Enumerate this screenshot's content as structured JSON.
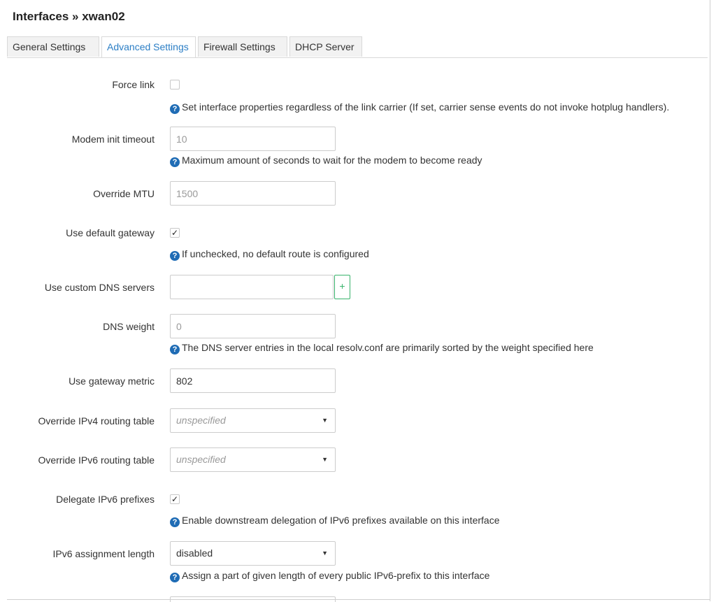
{
  "page": {
    "title": "Interfaces » xwan02"
  },
  "tabs": [
    {
      "label": "General Settings",
      "active": false
    },
    {
      "label": "Advanced Settings",
      "active": true
    },
    {
      "label": "Firewall Settings",
      "active": false
    },
    {
      "label": "DHCP Server",
      "active": false
    }
  ],
  "form": {
    "force_link": {
      "label": "Force link",
      "checked": false,
      "help": "Set interface properties regardless of the link carrier (If set, carrier sense events do not invoke hotplug handlers)."
    },
    "modem_init_timeout": {
      "label": "Modem init timeout",
      "value": "",
      "placeholder": "10",
      "help": "Maximum amount of seconds to wait for the modem to become ready"
    },
    "override_mtu": {
      "label": "Override MTU",
      "value": "",
      "placeholder": "1500"
    },
    "use_default_gateway": {
      "label": "Use default gateway",
      "checked": true,
      "check_glyph": "✓",
      "help": "If unchecked, no default route is configured"
    },
    "custom_dns": {
      "label": "Use custom DNS servers",
      "value": "",
      "add_label": "+"
    },
    "dns_weight": {
      "label": "DNS weight",
      "value": "",
      "placeholder": "0",
      "help": "The DNS server entries in the local resolv.conf are primarily sorted by the weight specified here"
    },
    "gateway_metric": {
      "label": "Use gateway metric",
      "value": "802"
    },
    "ipv4_routing_table": {
      "label": "Override IPv4 routing table",
      "value": "unspecified",
      "caret": "▼"
    },
    "ipv6_routing_table": {
      "label": "Override IPv6 routing table",
      "value": "unspecified",
      "caret": "▼"
    },
    "delegate_ipv6": {
      "label": "Delegate IPv6 prefixes",
      "checked": true,
      "check_glyph": "✓",
      "help": "Enable downstream delegation of IPv6 prefixes available on this interface"
    },
    "ipv6_assignment_length": {
      "label": "IPv6 assignment length",
      "value": "disabled",
      "caret": "▼",
      "help": "Assign a part of given length of every public IPv6-prefix to this interface"
    }
  },
  "icons": {
    "help_icon": "question-circle",
    "help_glyph": "?"
  },
  "colors": {
    "accent": "#2b7ec5",
    "help_icon": "#1f6cb5",
    "add_button": "#38b36b"
  }
}
